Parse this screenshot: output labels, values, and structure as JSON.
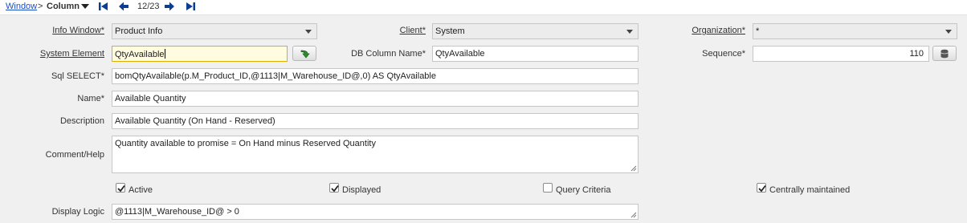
{
  "breadcrumb": {
    "parent_link": "Window",
    "separator": ">",
    "current": "Column",
    "record_counter": "12/23"
  },
  "icons": {
    "caret": "caret-down-icon",
    "first": "first-record-icon",
    "prev": "previous-record-icon",
    "next": "next-record-icon",
    "last": "last-record-icon",
    "element_lookup": "green-arrow-icon",
    "sequence_calc": "database-icon"
  },
  "colors": {
    "link": "#1a4fc4",
    "form_background": "#f0f0f0",
    "focused_field": "#fffce0",
    "readonly_field": "#ececec"
  },
  "form": {
    "info_window": {
      "label": "Info Window*",
      "value": "Product Info"
    },
    "client": {
      "label": "Client*",
      "value": "System"
    },
    "organization": {
      "label": "Organization*",
      "value": "*"
    },
    "system_element": {
      "label": "System Element",
      "value": "QtyAvailable"
    },
    "db_column_name": {
      "label": "DB Column Name*",
      "value": "QtyAvailable"
    },
    "sequence": {
      "label": "Sequence*",
      "value": "110"
    },
    "sql_select": {
      "label": "Sql SELECT*",
      "value": "bomQtyAvailable(p.M_Product_ID,@1113|M_Warehouse_ID@,0) AS QtyAvailable"
    },
    "name": {
      "label": "Name*",
      "value": "Available Quantity"
    },
    "description": {
      "label": "Description",
      "value": "Available Quantity (On Hand - Reserved)"
    },
    "comment_help": {
      "label": "Comment/Help",
      "value": "Quantity available to promise = On Hand minus Reserved Quantity"
    },
    "active": {
      "label": "Active",
      "checked": true
    },
    "displayed": {
      "label": "Displayed",
      "checked": true
    },
    "query_criteria": {
      "label": "Query Criteria",
      "checked": false
    },
    "centrally_maintained": {
      "label": "Centrally maintained",
      "checked": true
    },
    "display_logic": {
      "label": "Display Logic",
      "value": "@1113|M_Warehouse_ID@ > 0"
    }
  }
}
